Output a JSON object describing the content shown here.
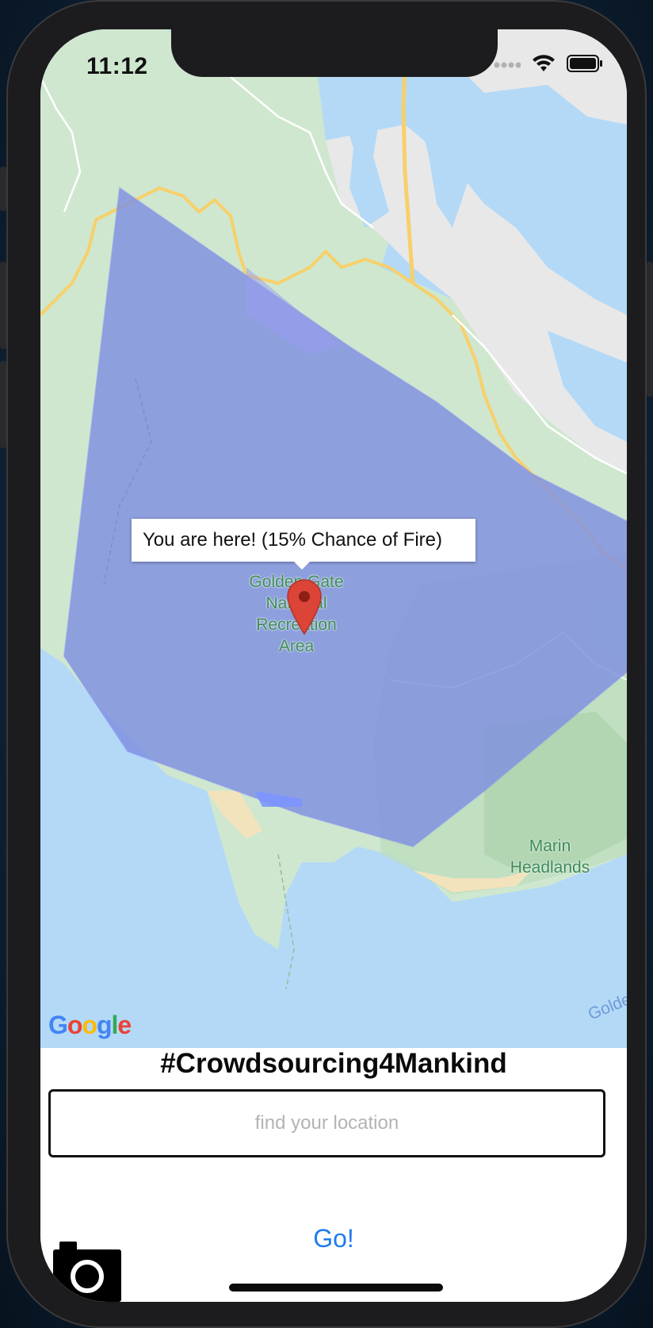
{
  "status_bar": {
    "time": "11:12",
    "icons": [
      "signal-dots-icon",
      "wifi-icon",
      "battery-icon"
    ]
  },
  "map": {
    "provider_logo": "Google",
    "callout_text": "You are here! (15% Chance of Fire)",
    "labels": {
      "park_line1": "Golden Gate",
      "park_line2": "National",
      "park_line3": "Recreation",
      "park_line4": "Area",
      "headlands_line1": "Marin",
      "headlands_line2": "Headlands",
      "edge_label": "Golde"
    },
    "colors": {
      "water": "#b3d9f7",
      "park": "#cfe7cf",
      "urban": "#e8e8e8",
      "road": "#f7d06b",
      "fire_zone": "#7f8fe0",
      "pin": "#db4437"
    }
  },
  "footer": {
    "tagline": "#Crowdsourcing4Mankind",
    "search": {
      "placeholder": "find your location",
      "value": ""
    },
    "go_label": "Go!",
    "camera_icon": "camera-icon"
  }
}
